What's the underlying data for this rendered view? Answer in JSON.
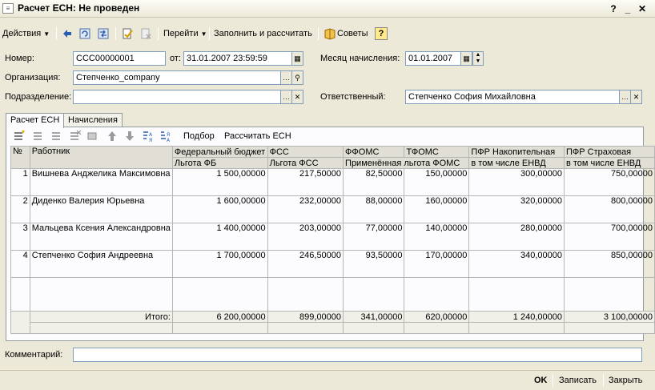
{
  "window": {
    "title": "Расчет ЕСН: Не проведен",
    "icon": "document-icon"
  },
  "toolbar": {
    "actions_label": "Действия",
    "goto_label": "Перейти",
    "fill_calc_label": "Заполнить и рассчитать",
    "tips_label": "Советы",
    "help_label": "?"
  },
  "form": {
    "number_label": "Номер:",
    "number_value": "CCC00000001",
    "date_label": "от:",
    "date_value": "31.01.2007 23:59:59",
    "month_label": "Месяц начисления:",
    "month_value": "01.01.2007",
    "org_label": "Организация:",
    "org_value": "Степченко_company",
    "division_label": "Подразделение:",
    "division_value": "",
    "responsible_label": "Ответственный:",
    "responsible_value": "Степченко София Михайловна"
  },
  "tabs": [
    {
      "label": "Расчет ЕСН",
      "active": true
    },
    {
      "label": "Начисления",
      "active": false
    }
  ],
  "grid_toolbar": {
    "pick_label": "Подбор",
    "calc_label": "Рассчитать ЕСН"
  },
  "grid": {
    "header1": [
      "№",
      "Работник",
      "Федеральный бюджет",
      "ФСС",
      "ФФОМС",
      "ТФОМС",
      "ПФР Накопительная",
      "ПФР Страховая"
    ],
    "header2": [
      "Льгота ФБ",
      "Льгота ФСС",
      "Применённая льгота ФОМС",
      "в том числе ЕНВД",
      "в том числе ЕНВД"
    ],
    "rows": [
      {
        "n": "1",
        "name": "Вишнева Анджелика Максимовна",
        "fb": "1 500,00000",
        "fss": "217,50000",
        "ffoms": "82,50000",
        "tfoms": "150,00000",
        "pfr_n": "300,00000",
        "pfr_s": "750,00000"
      },
      {
        "n": "2",
        "name": "Диденко Валерия Юрьевна",
        "fb": "1 600,00000",
        "fss": "232,00000",
        "ffoms": "88,00000",
        "tfoms": "160,00000",
        "pfr_n": "320,00000",
        "pfr_s": "800,00000"
      },
      {
        "n": "3",
        "name": "Мальцева Ксения Александровна",
        "fb": "1 400,00000",
        "fss": "203,00000",
        "ffoms": "77,00000",
        "tfoms": "140,00000",
        "pfr_n": "280,00000",
        "pfr_s": "700,00000"
      },
      {
        "n": "4",
        "name": "Степченко София Андреевна",
        "fb": "1 700,00000",
        "fss": "246,50000",
        "ffoms": "93,50000",
        "tfoms": "170,00000",
        "pfr_n": "340,00000",
        "pfr_s": "850,00000"
      }
    ],
    "totals": {
      "label": "Итого:",
      "fb": "6 200,00000",
      "fss": "899,00000",
      "ffoms": "341,00000",
      "tfoms": "620,00000",
      "pfr_n": "1 240,00000",
      "pfr_s": "3 100,00000"
    }
  },
  "comment": {
    "label": "Комментарий:",
    "value": ""
  },
  "buttons": {
    "ok": "OK",
    "write": "Записать",
    "close": "Закрыть"
  }
}
